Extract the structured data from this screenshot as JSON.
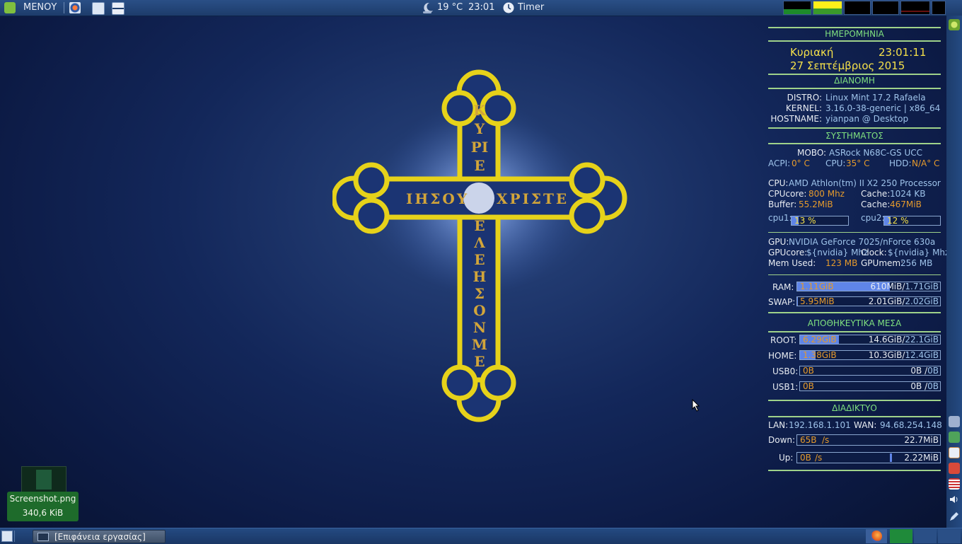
{
  "top_panel": {
    "menu_label": "ΜΕΝΟΥ",
    "weather_temp": "19 °C",
    "clock": "23:01",
    "timer_label": "Timer",
    "icons": [
      "mint-logo-icon",
      "browser-icon",
      "files-icon",
      "windows-icon",
      "weather-moon-icon",
      "timer-clock-icon"
    ]
  },
  "wallpaper": {
    "cross_text_vertical_top": "ΚΥΡΙΕ",
    "cross_text_left": "ΙΗΣΟΥ",
    "cross_text_right": "ΧΡΙΣΤΕ",
    "cross_text_vertical_bottom": "ΕΛΕΗΣΟΝ ΜΕ"
  },
  "conky": {
    "date_title": "ΗΜΕΡΟΜΗΝΙΑ",
    "day": "Κυριακή",
    "time": "23:01:11",
    "date": "27  Σεπτέμβριος  2015",
    "distro_title": "ΔΙΑΝΟΜΗ",
    "distro_label": "DISTRO:",
    "distro_value": "Linux Mint 17.2 Rafaela",
    "kernel_label": "KERNEL:",
    "kernel_value": "3.16.0-38-generic | x86_64",
    "hostname_label": "HOSTNAME:",
    "hostname_value": "yianpan @ Desktop",
    "system_title": "ΣΥΣΤΗΜΑΤΟΣ",
    "mobo_label": "MOBO:",
    "mobo_value": "ASRock N68C-GS UCC",
    "acpi_label": "ACPI:",
    "acpi_value": "0° C",
    "cpu_temp_label": "CPU:",
    "cpu_temp_value": "35° C",
    "hdd_label": "HDD:",
    "hdd_value": "N/A° C",
    "cpu_label": "CPU:",
    "cpu_value": "AMD Athlon(tm) II X2 250 Processor",
    "cpucore_label": "CPUcore:",
    "cpucore_value": "800 Mhz",
    "cache_label": "Cache:",
    "cache_value": "1024 KB",
    "buffer_label": "Buffer:",
    "buffer_value": "55.2MiB",
    "cache2_label": "Cache:",
    "cache2_value": "467MiB",
    "cpu1_label": "cpu1:",
    "cpu1_text": "13 %",
    "cpu1_pct": 13,
    "cpu2_label": "cpu2:",
    "cpu2_text": "12 %",
    "cpu2_pct": 12,
    "gpu_label": "GPU:",
    "gpu_value": "NVIDIA GeForce 7025/nForce 630a",
    "gpucore_label": "GPUcore:",
    "gpucore_value": "${nvidia} Mhz",
    "clock_label": "Clock:",
    "clock_value": "${nvidia} Mhz",
    "memused_label": "Mem Used:",
    "memused_value": "123 MB",
    "gpumem_label": "GPUmem:",
    "gpumem_value": "256 MB",
    "ram_label": "RAM:",
    "ram_used": "1.11GiB",
    "ram_free": "610",
    "ram_free_unit": "MiB",
    "ram_total": "1.71GiB",
    "ram_pct": 65,
    "swap_label": "SWAP:",
    "swap_used": "5.95MiB",
    "swap_free": "2.01GiB",
    "swap_total": "2.02GiB",
    "swap_pct": 0.3,
    "storage_title": "ΑΠΟΘΗΚΕΥΤΙΚΑ ΜΕΣΑ",
    "root_label": "ROOT:",
    "root_used": "6.29GiB",
    "root_free": "14.6GiB",
    "root_total": "22.1GiB",
    "root_pct": 28,
    "home_label": "HOME:",
    "home_used": "1.38GiB",
    "home_free": "10.3GiB",
    "home_total": "12.4GiB",
    "home_pct": 11,
    "usb0_label": "USB0:",
    "usb0_used": "0B",
    "usb0_free": "0B",
    "usb0_total": "0B",
    "usb1_label": "USB1:",
    "usb1_used": "0B",
    "usb1_free": "0B",
    "usb1_total": "0B",
    "net_title": "ΔΙΑΔΙΚΤΥΟ",
    "lan_label": "LAN:",
    "lan_value": "192.168.1.101",
    "wan_label": "WAN:",
    "wan_value": "94.68.254.148",
    "down_label": "Down:",
    "down_speed": "65B",
    "down_unit": "/s",
    "down_total": "22.7MiB",
    "up_label": "Up:",
    "up_speed": "0B",
    "up_unit": "/s",
    "up_total": "2.22MiB"
  },
  "desktop_icon": {
    "name": "Screenshot.png",
    "size": "340,6 KiB"
  },
  "taskbar": {
    "window_title": "[Επιφάνεια εργασίας]"
  },
  "colors": {
    "accent_green": "#9fd28a",
    "orange_value": "#e59a2c",
    "blue_value": "#9ec3ea",
    "cross_gold": "#e6d21a",
    "bar_fill": "#5f85e8"
  }
}
